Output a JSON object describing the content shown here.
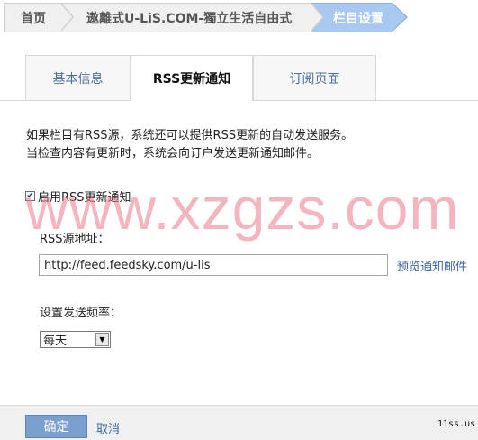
{
  "breadcrumb": {
    "home": "首页",
    "site": "遨離式U-LiS.COM-獨立生活自由式",
    "current": "栏目设置"
  },
  "tabs": [
    {
      "label": "基本信息",
      "active": false
    },
    {
      "label": "RSS更新通知",
      "active": true
    },
    {
      "label": "订阅页面",
      "active": false
    }
  ],
  "description": {
    "line1": "如果栏目有RSS源，系统还可以提供RSS更新的自动发送服务。",
    "line2": "当检查内容有更新时，系统会向订户发送更新通知邮件。"
  },
  "enable": {
    "label": "启用RSS更新通知",
    "checked": true,
    "check_glyph": "✔"
  },
  "rss": {
    "label": "RSS源地址：",
    "value": "http://feed.feedsky.com/u-lis",
    "preview_link": "预览通知邮件"
  },
  "frequency": {
    "label": "设置发送频率：",
    "selected": "每天",
    "arrow_glyph": "▼"
  },
  "footer": {
    "ok_label": "确定",
    "cancel_label": "取消"
  },
  "watermark": {
    "big": "www.xzgzs.com",
    "small": "11ss.us"
  },
  "colors": {
    "accent": "#a9c8ef",
    "link": "#3a64a8",
    "ok_button": "#7b9fce",
    "watermark": "#ec788c"
  }
}
